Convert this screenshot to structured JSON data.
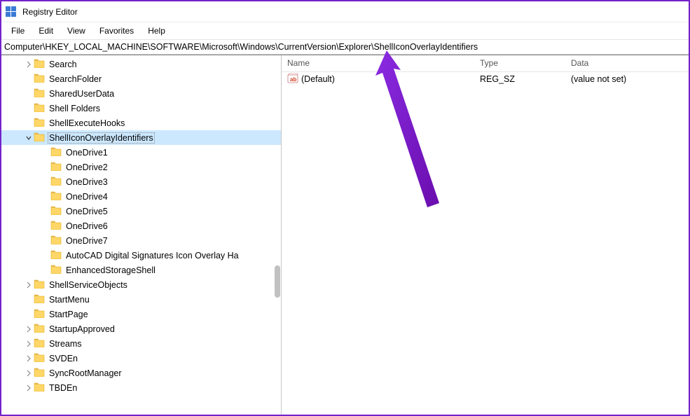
{
  "window": {
    "title": "Registry Editor"
  },
  "menubar": {
    "items": [
      {
        "label": "File"
      },
      {
        "label": "Edit"
      },
      {
        "label": "View"
      },
      {
        "label": "Favorites"
      },
      {
        "label": "Help"
      }
    ]
  },
  "addressbar": {
    "path": "Computer\\HKEY_LOCAL_MACHINE\\SOFTWARE\\Microsoft\\Windows\\CurrentVersion\\Explorer\\ShellIconOverlayIdentifiers"
  },
  "tree": {
    "items": [
      {
        "label": "Search",
        "depth": 1,
        "expander": "closed",
        "selected": false
      },
      {
        "label": "SearchFolder",
        "depth": 1,
        "expander": "none",
        "selected": false
      },
      {
        "label": "SharedUserData",
        "depth": 1,
        "expander": "none",
        "selected": false
      },
      {
        "label": "Shell Folders",
        "depth": 1,
        "expander": "none",
        "selected": false
      },
      {
        "label": "ShellExecuteHooks",
        "depth": 1,
        "expander": "none",
        "selected": false
      },
      {
        "label": "ShellIconOverlayIdentifiers",
        "depth": 1,
        "expander": "open",
        "selected": true
      },
      {
        "label": "OneDrive1",
        "depth": 2,
        "expander": "none",
        "selected": false
      },
      {
        "label": "OneDrive2",
        "depth": 2,
        "expander": "none",
        "selected": false
      },
      {
        "label": "OneDrive3",
        "depth": 2,
        "expander": "none",
        "selected": false
      },
      {
        "label": "OneDrive4",
        "depth": 2,
        "expander": "none",
        "selected": false
      },
      {
        "label": "OneDrive5",
        "depth": 2,
        "expander": "none",
        "selected": false
      },
      {
        "label": "OneDrive6",
        "depth": 2,
        "expander": "none",
        "selected": false
      },
      {
        "label": "OneDrive7",
        "depth": 2,
        "expander": "none",
        "selected": false
      },
      {
        "label": "AutoCAD Digital Signatures Icon Overlay Ha",
        "depth": 2,
        "expander": "none",
        "selected": false
      },
      {
        "label": "EnhancedStorageShell",
        "depth": 2,
        "expander": "none",
        "selected": false
      },
      {
        "label": "ShellServiceObjects",
        "depth": 1,
        "expander": "closed",
        "selected": false
      },
      {
        "label": "StartMenu",
        "depth": 1,
        "expander": "none",
        "selected": false
      },
      {
        "label": "StartPage",
        "depth": 1,
        "expander": "none",
        "selected": false
      },
      {
        "label": "StartupApproved",
        "depth": 1,
        "expander": "closed",
        "selected": false
      },
      {
        "label": "Streams",
        "depth": 1,
        "expander": "closed",
        "selected": false
      },
      {
        "label": "SVDEn",
        "depth": 1,
        "expander": "closed",
        "selected": false
      },
      {
        "label": "SyncRootManager",
        "depth": 1,
        "expander": "closed",
        "selected": false
      },
      {
        "label": "TBDEn",
        "depth": 1,
        "expander": "closed",
        "selected": false
      }
    ]
  },
  "list": {
    "headers": {
      "name": "Name",
      "type": "Type",
      "data": "Data"
    },
    "rows": [
      {
        "name": "(Default)",
        "type": "REG_SZ",
        "data": "(value not set)"
      }
    ]
  }
}
